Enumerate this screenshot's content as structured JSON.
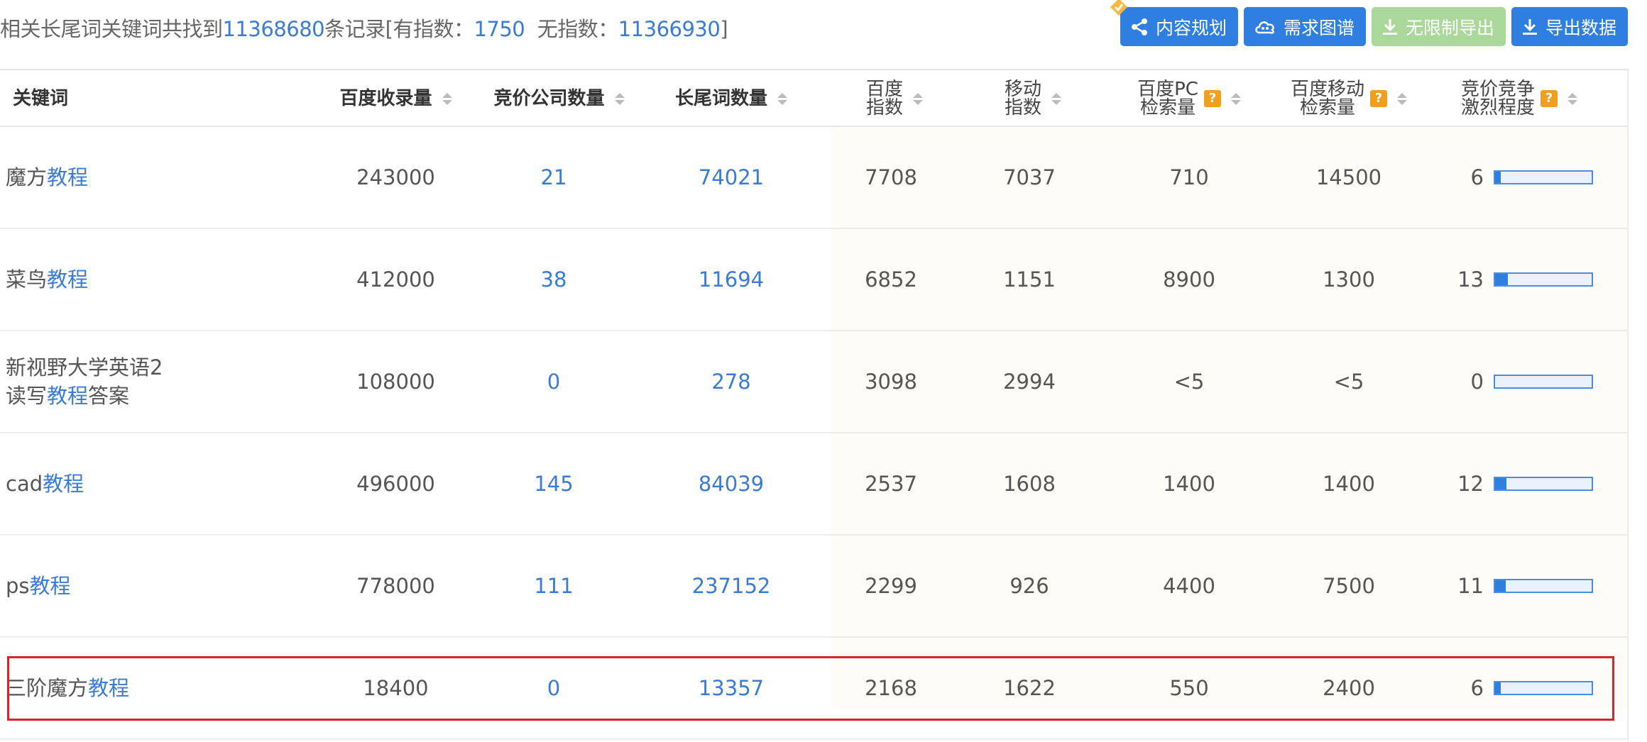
{
  "summary": {
    "prefix": "相关长尾词关键词共找到",
    "total": "11368680",
    "mid": "条记录[有指数：",
    "with_index": "1750",
    "sep": "无指数：",
    "without_index": "11366930",
    "suffix": "]"
  },
  "toolbar": {
    "content_plan": "内容规划",
    "demand_map": "需求图谱",
    "unlimited_export": "无限制导出",
    "export_data": "导出数据"
  },
  "headers": {
    "keyword": "关键词",
    "baidu_indexed": "百度收录量",
    "bid_companies": "竞价公司数量",
    "longtail_count": "长尾词数量",
    "baidu_index_1": "百度",
    "baidu_index_2": "指数",
    "mobile_index_1": "移动",
    "mobile_index_2": "指数",
    "pc_search_1": "百度PC",
    "pc_search_2": "检索量",
    "mobile_search_1": "百度移动",
    "mobile_search_2": "检索量",
    "competition_1": "竞价竞争",
    "competition_2": "激烈程度",
    "help": "?"
  },
  "rows": [
    {
      "kw_pre": "魔方",
      "kw_hl": "教程",
      "kw_post": "",
      "kw_line2_pre": "",
      "kw_line2_hl": "",
      "kw_line2_post": "",
      "indexed": "243000",
      "companies": "21",
      "longtail": "74021",
      "baidu_index": "7708",
      "mobile_index": "7037",
      "pc": "710",
      "mobile": "14500",
      "competition": "6",
      "competition_level": 0.06
    },
    {
      "kw_pre": "菜鸟",
      "kw_hl": "教程",
      "kw_post": "",
      "kw_line2_pre": "",
      "kw_line2_hl": "",
      "kw_line2_post": "",
      "indexed": "412000",
      "companies": "38",
      "longtail": "11694",
      "baidu_index": "6852",
      "mobile_index": "1151",
      "pc": "8900",
      "mobile": "1300",
      "competition": "13",
      "competition_level": 0.13
    },
    {
      "kw_pre": "新视野大学英语2",
      "kw_hl": "",
      "kw_post": "",
      "kw_line2_pre": "读写",
      "kw_line2_hl": "教程",
      "kw_line2_post": "答案",
      "indexed": "108000",
      "companies": "0",
      "longtail": "278",
      "baidu_index": "3098",
      "mobile_index": "2994",
      "pc": "<5",
      "mobile": "<5",
      "competition": "0",
      "competition_level": 0.0
    },
    {
      "kw_pre": "cad",
      "kw_hl": "教程",
      "kw_post": "",
      "kw_line2_pre": "",
      "kw_line2_hl": "",
      "kw_line2_post": "",
      "indexed": "496000",
      "companies": "145",
      "longtail": "84039",
      "baidu_index": "2537",
      "mobile_index": "1608",
      "pc": "1400",
      "mobile": "1400",
      "competition": "12",
      "competition_level": 0.12
    },
    {
      "kw_pre": "ps",
      "kw_hl": "教程",
      "kw_post": "",
      "kw_line2_pre": "",
      "kw_line2_hl": "",
      "kw_line2_post": "",
      "indexed": "778000",
      "companies": "111",
      "longtail": "237152",
      "baidu_index": "2299",
      "mobile_index": "926",
      "pc": "4400",
      "mobile": "7500",
      "competition": "11",
      "competition_level": 0.11
    },
    {
      "kw_pre": "三阶魔方",
      "kw_hl": "教程",
      "kw_post": "",
      "kw_line2_pre": "",
      "kw_line2_hl": "",
      "kw_line2_post": "",
      "indexed": "18400",
      "companies": "0",
      "longtail": "13357",
      "baidu_index": "2168",
      "mobile_index": "1622",
      "pc": "550",
      "mobile": "2400",
      "competition": "6",
      "competition_level": 0.06
    }
  ],
  "colors": {
    "accent": "#2f7fe0",
    "link": "#3a7bd5",
    "export_disabled": "#a9d89a",
    "highlight_border": "#d9232a",
    "help_badge": "#f0a020"
  },
  "icons": [
    "share-icon",
    "cloud-icon",
    "download-icon",
    "download-icon",
    "vip-badge-icon",
    "sort-icon",
    "help-icon"
  ]
}
